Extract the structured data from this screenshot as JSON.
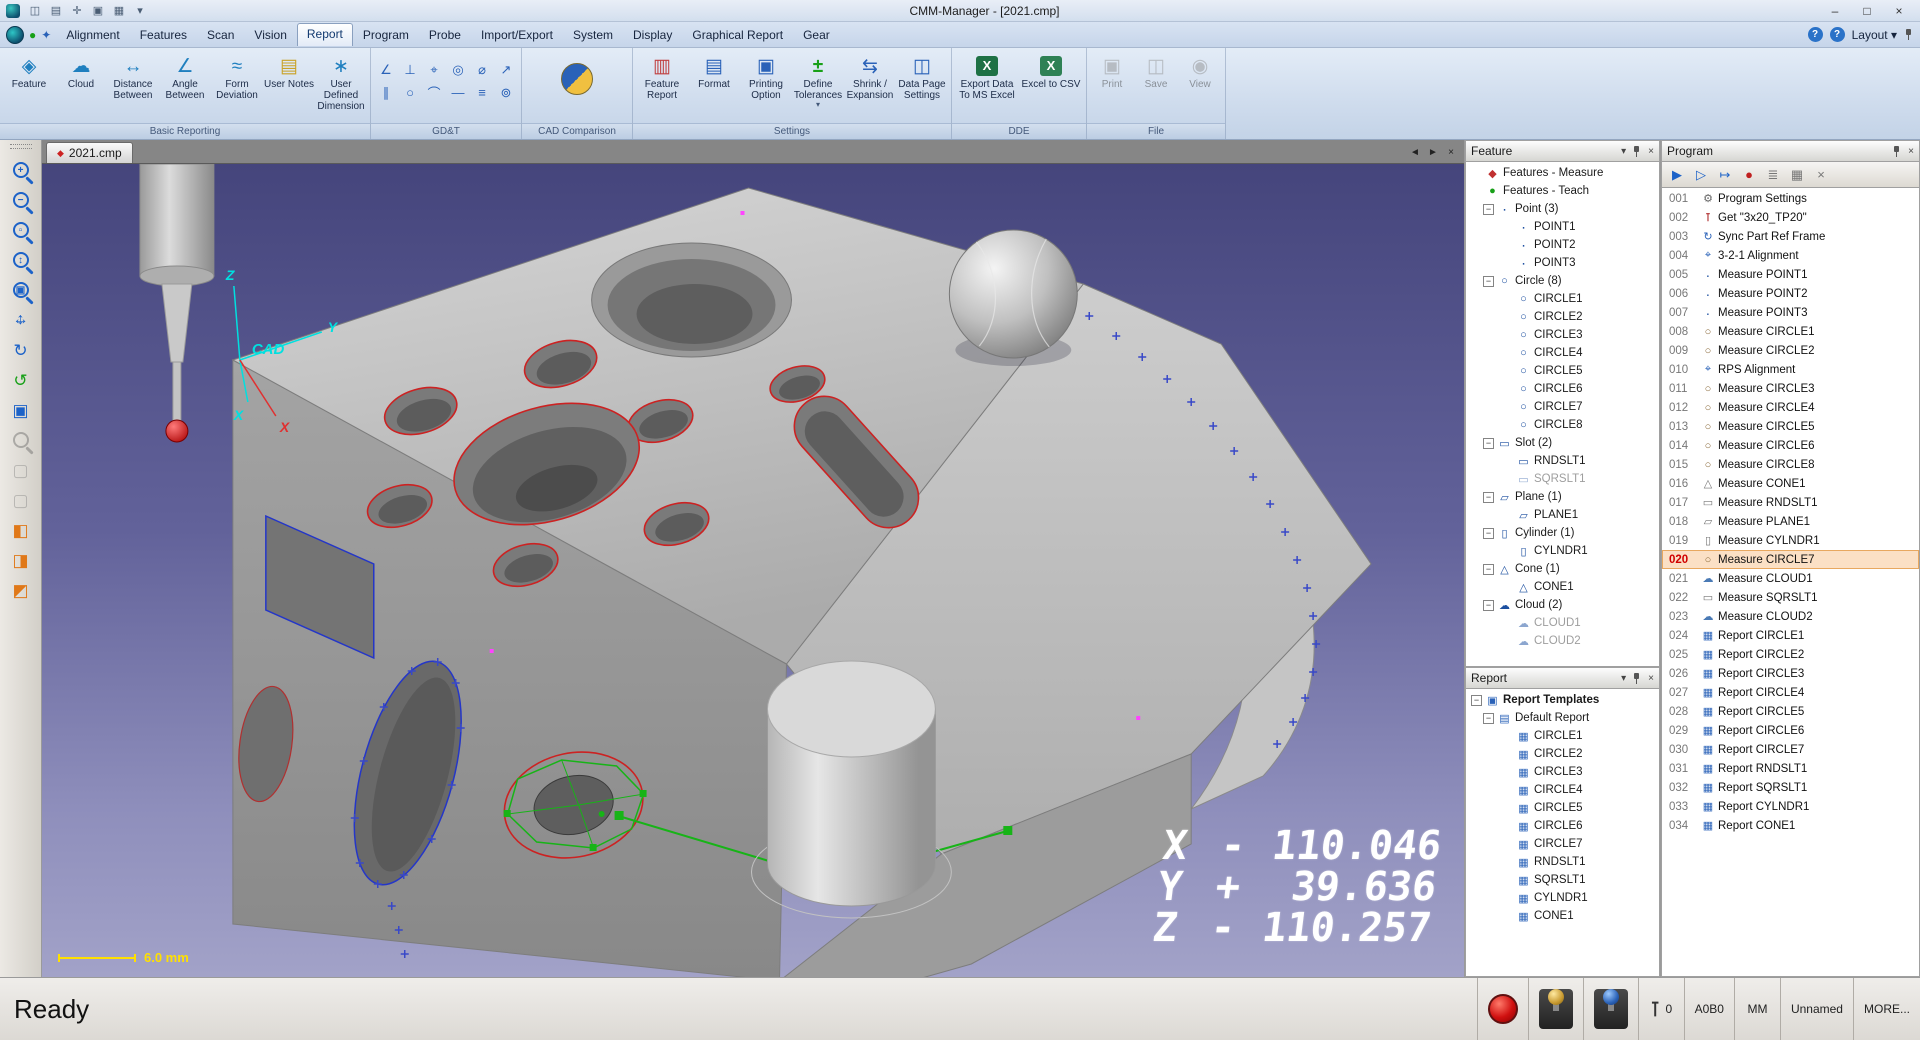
{
  "window": {
    "title": "CMM-Manager - [2021.cmp]",
    "controls": {
      "minimize": "–",
      "maximize": "□",
      "close": "×"
    },
    "quick_icons": [
      {
        "name": "save-icon",
        "glyph": "◫"
      },
      {
        "name": "print-icon",
        "glyph": "▤"
      },
      {
        "name": "probe-setup-icon",
        "glyph": "✛"
      },
      {
        "name": "display-mode-icon",
        "glyph": "▣"
      },
      {
        "name": "report-window-icon",
        "glyph": "▦"
      },
      {
        "name": "customize-quick-access-icon",
        "glyph": "▾"
      }
    ]
  },
  "menubar": {
    "items": [
      {
        "label": "Alignment"
      },
      {
        "label": "Features"
      },
      {
        "label": "Scan"
      },
      {
        "label": "Vision"
      },
      {
        "label": "Report",
        "cls": "active"
      },
      {
        "label": "Program"
      },
      {
        "label": "Probe"
      },
      {
        "label": "Import/Export"
      },
      {
        "label": "System"
      },
      {
        "label": "Display"
      },
      {
        "label": "Graphical Report"
      },
      {
        "label": "Gear"
      }
    ],
    "help_glyph": "?",
    "info_glyph": "?",
    "layout_label": "Layout",
    "layout_caret": "▾"
  },
  "ribbon": {
    "basic": {
      "label": "Basic Reporting",
      "buttons": [
        {
          "label": "Feature",
          "icon": "i-feature"
        },
        {
          "label": "Cloud",
          "icon": "i-cloud"
        },
        {
          "label": "Distance Between",
          "icon": "i-distance"
        },
        {
          "label": "Angle Between",
          "icon": "i-angle"
        },
        {
          "label": "Form Deviation",
          "icon": "i-form"
        },
        {
          "label": "User Notes",
          "icon": "i-notes"
        },
        {
          "label": "User Defined Dimension",
          "icon": "i-udd"
        }
      ]
    },
    "gdt": {
      "label": "GD&T",
      "tools": [
        {
          "name": "angularity-icon",
          "glyph": "∠"
        },
        {
          "name": "perpendicularity-icon",
          "glyph": "⊥"
        },
        {
          "name": "position-icon",
          "glyph": "⌖"
        },
        {
          "name": "concentricity-icon",
          "glyph": "◎"
        },
        {
          "name": "diameter-icon",
          "glyph": "⌀"
        },
        {
          "name": "runout-icon",
          "glyph": "↗"
        },
        {
          "name": "parallelism-icon",
          "glyph": "∥"
        },
        {
          "name": "circularity-icon",
          "glyph": "○"
        },
        {
          "name": "profile-icon",
          "glyph": "⌒"
        },
        {
          "name": "straightness-icon",
          "glyph": "—"
        },
        {
          "name": "symmetry-icon",
          "glyph": "≡"
        },
        {
          "name": "total-runout-icon",
          "glyph": "⊚"
        }
      ]
    },
    "cad": {
      "label": "CAD Comparison"
    },
    "settings": {
      "label": "Settings",
      "buttons": [
        {
          "label": "Feature Report",
          "icon": "i-freport"
        },
        {
          "label": "Format",
          "icon": "i-format"
        },
        {
          "label": "Printing Option",
          "icon": "i-print"
        },
        {
          "label": "Define Tolerances",
          "icon": "i-tol",
          "caret": "▾"
        },
        {
          "label": "Shrink / Expansion",
          "icon": "i-shrink"
        },
        {
          "label": "Data Page Settings",
          "icon": "i-datapage"
        }
      ]
    },
    "dde": {
      "label": "DDE",
      "buttons": [
        {
          "label": "Export Data To MS Excel",
          "icon": "i-excel"
        },
        {
          "label": "Excel to CSV",
          "icon": "i-excel2"
        }
      ]
    },
    "file": {
      "label": "File",
      "buttons": [
        {
          "label": "Print",
          "icon": "i-fprint",
          "cls": "disabled"
        },
        {
          "label": "Save",
          "icon": "i-fsave",
          "cls": "disabled"
        },
        {
          "label": "View",
          "icon": "i-fview",
          "cls": "disabled"
        }
      ]
    }
  },
  "side_toolbar": {
    "tools": [
      {
        "name": "zoom-in-tool",
        "cls": "kind-mag",
        "sub": "+"
      },
      {
        "name": "zoom-out-tool",
        "cls": "kind-mag",
        "sub": "−"
      },
      {
        "name": "zoom-window-tool",
        "cls": "kind-mag",
        "sub": "▫"
      },
      {
        "name": "zoom-dynamic-tool",
        "cls": "kind-mag",
        "sub": "↕"
      },
      {
        "name": "zoom-fit-tool",
        "cls": "kind-mag",
        "sub": "▣"
      },
      {
        "name": "pan-tool",
        "cls": "kind-pan"
      },
      {
        "name": "rotate-view-tool",
        "cls": "kind-glyph c-blue",
        "glyph": "↻"
      },
      {
        "name": "rotate-3d-tool",
        "cls": "kind-glyph c-green",
        "glyph": "↺"
      },
      {
        "name": "view-control-tool",
        "cls": "kind-glyph c-blue",
        "glyph": "▣"
      },
      {
        "name": "probe-zoom-tool",
        "cls": "kind-mag dis",
        "sub": ""
      },
      {
        "name": "select-feature-tool",
        "cls": "kind-glyph c-gray dis",
        "glyph": "▢"
      },
      {
        "name": "select-surface-tool",
        "cls": "kind-glyph c-gray dis",
        "glyph": "▢"
      },
      {
        "name": "iso-view-tool",
        "cls": "kind-glyph c-orange",
        "glyph": "◧"
      },
      {
        "name": "front-view-tool",
        "cls": "kind-glyph c-orange",
        "glyph": "◨"
      },
      {
        "name": "side-view-tool",
        "cls": "kind-glyph c-orange",
        "glyph": "◩"
      }
    ]
  },
  "viewport": {
    "tab": {
      "label": "2021.cmp",
      "icon_glyph": "◆"
    },
    "nav": {
      "prev": "◄",
      "next": "►",
      "close": "×"
    },
    "scale_label": "6.0 mm",
    "axis": {
      "z": "Z",
      "y": "Y",
      "x": "X",
      "x_red": "X",
      "cad": "CAD"
    },
    "dro": [
      {
        "axis": "X",
        "sign": "-",
        "value": "110.046"
      },
      {
        "axis": "Y",
        "sign": "+",
        "value": "39.636"
      },
      {
        "axis": "Z",
        "sign": "-",
        "value": "110.257"
      }
    ]
  },
  "feature_panel": {
    "title": "Feature",
    "rows": [
      {
        "cls": "lvl0",
        "icon": "t-measure",
        "label": "Features - Measure"
      },
      {
        "cls": "lvl0",
        "icon": "t-teach",
        "label": "Features - Teach"
      },
      {
        "cls": "lvl1",
        "exp": "box",
        "icon": "t-point",
        "label": "Point (3)"
      },
      {
        "cls": "lvl2",
        "icon": "t-point",
        "label": "POINT1"
      },
      {
        "cls": "lvl2",
        "icon": "t-point",
        "label": "POINT2"
      },
      {
        "cls": "lvl2",
        "icon": "t-point",
        "label": "POINT3"
      },
      {
        "cls": "lvl1",
        "exp": "box",
        "icon": "t-circle",
        "label": "Circle (8)"
      },
      {
        "cls": "lvl2",
        "icon": "t-circle",
        "label": "CIRCLE1"
      },
      {
        "cls": "lvl2",
        "icon": "t-circle",
        "label": "CIRCLE2"
      },
      {
        "cls": "lvl2",
        "icon": "t-circle",
        "label": "CIRCLE3"
      },
      {
        "cls": "lvl2",
        "icon": "t-circle",
        "label": "CIRCLE4"
      },
      {
        "cls": "lvl2",
        "icon": "t-circle",
        "label": "CIRCLE5"
      },
      {
        "cls": "lvl2",
        "icon": "t-circle",
        "label": "CIRCLE6"
      },
      {
        "cls": "lvl2",
        "icon": "t-circle",
        "label": "CIRCLE7"
      },
      {
        "cls": "lvl2",
        "icon": "t-circle",
        "label": "CIRCLE8"
      },
      {
        "cls": "lvl1",
        "exp": "box",
        "icon": "t-slot",
        "label": "Slot (2)"
      },
      {
        "cls": "lvl2",
        "icon": "t-slot",
        "label": "RNDSLT1"
      },
      {
        "cls": "lvl2 gray",
        "icon": "t-slot",
        "label": "SQRSLT1"
      },
      {
        "cls": "lvl1",
        "exp": "box",
        "icon": "t-plane",
        "label": "Plane (1)"
      },
      {
        "cls": "lvl2",
        "icon": "t-plane",
        "label": "PLANE1"
      },
      {
        "cls": "lvl1",
        "exp": "box",
        "icon": "t-cyl",
        "label": "Cylinder (1)"
      },
      {
        "cls": "lvl2",
        "icon": "t-cyl",
        "label": "CYLNDR1"
      },
      {
        "cls": "lvl1",
        "exp": "box",
        "icon": "t-cone",
        "label": "Cone (1)"
      },
      {
        "cls": "lvl2",
        "icon": "t-cone",
        "label": "CONE1"
      },
      {
        "cls": "lvl1",
        "exp": "box",
        "icon": "t-cloud",
        "label": "Cloud (2)"
      },
      {
        "cls": "lvl2 gray",
        "icon": "t-cloud",
        "label": "CLOUD1"
      },
      {
        "cls": "lvl2 gray",
        "icon": "t-cloud",
        "label": "CLOUD2"
      }
    ]
  },
  "report_panel": {
    "title": "Report",
    "rows": [
      {
        "cls": "lvl0 bold",
        "exp": "box",
        "icon": "t-rpt-root",
        "label": "Report Templates"
      },
      {
        "cls": "lvl1",
        "exp": "box",
        "icon": "t-rpt",
        "label": "Default Report"
      },
      {
        "cls": "lvl2",
        "icon": "t-rpt-i",
        "label": "CIRCLE1"
      },
      {
        "cls": "lvl2",
        "icon": "t-rpt-i",
        "label": "CIRCLE2"
      },
      {
        "cls": "lvl2",
        "icon": "t-rpt-i",
        "label": "CIRCLE3"
      },
      {
        "cls": "lvl2",
        "icon": "t-rpt-i",
        "label": "CIRCLE4"
      },
      {
        "cls": "lvl2",
        "icon": "t-rpt-i",
        "label": "CIRCLE5"
      },
      {
        "cls": "lvl2",
        "icon": "t-rpt-i",
        "label": "CIRCLE6"
      },
      {
        "cls": "lvl2",
        "icon": "t-rpt-i",
        "label": "CIRCLE7"
      },
      {
        "cls": "lvl2",
        "icon": "t-rpt-i",
        "label": "RNDSLT1"
      },
      {
        "cls": "lvl2",
        "icon": "t-rpt-i",
        "label": "SQRSLT1"
      },
      {
        "cls": "lvl2",
        "icon": "t-rpt-i",
        "label": "CYLNDR1"
      },
      {
        "cls": "lvl2",
        "icon": "t-rpt-i",
        "label": "CONE1"
      }
    ]
  },
  "program_panel": {
    "title": "Program",
    "toolbar": [
      {
        "name": "run-program-button",
        "glyph": "▶",
        "cls": "c-blue"
      },
      {
        "name": "run-from-current-button",
        "glyph": "▷",
        "cls": "c-blue"
      },
      {
        "name": "step-run-button",
        "glyph": "↦",
        "cls": "c-blue"
      },
      {
        "name": "breakpoint-button",
        "glyph": "●",
        "cls": "c-red"
      },
      {
        "name": "list-options-button",
        "glyph": "≣",
        "cls": "c-gray"
      },
      {
        "name": "program-windows-button",
        "glyph": "▦",
        "cls": "c-gray"
      },
      {
        "name": "delete-line-button",
        "glyph": "×",
        "cls": "c-gray"
      }
    ],
    "rows": [
      {
        "num": "001",
        "icon": "k-settings",
        "label": "Program Settings"
      },
      {
        "num": "002",
        "icon": "k-probe",
        "label": "Get \"3x20_TP20\""
      },
      {
        "num": "003",
        "icon": "k-sync",
        "label": "Sync Part Ref Frame"
      },
      {
        "num": "004",
        "icon": "k-align",
        "label": "3-2-1 Alignment"
      },
      {
        "num": "005",
        "icon": "k-point",
        "label": "Measure POINT1"
      },
      {
        "num": "006",
        "icon": "k-point",
        "label": "Measure POINT2"
      },
      {
        "num": "007",
        "icon": "k-point",
        "label": "Measure POINT3"
      },
      {
        "num": "008",
        "icon": "k-circle",
        "label": "Measure CIRCLE1"
      },
      {
        "num": "009",
        "icon": "k-circle",
        "label": "Measure CIRCLE2"
      },
      {
        "num": "010",
        "icon": "k-align",
        "label": "RPS Alignment"
      },
      {
        "num": "011",
        "icon": "k-circle",
        "label": "Measure CIRCLE3"
      },
      {
        "num": "012",
        "icon": "k-circle",
        "label": "Measure CIRCLE4"
      },
      {
        "num": "013",
        "icon": "k-circle",
        "label": "Measure CIRCLE5"
      },
      {
        "num": "014",
        "icon": "k-circle",
        "label": "Measure CIRCLE6"
      },
      {
        "num": "015",
        "icon": "k-circle",
        "label": "Measure CIRCLE8"
      },
      {
        "num": "016",
        "icon": "k-cone",
        "label": "Measure CONE1"
      },
      {
        "num": "017",
        "icon": "k-slot",
        "label": "Measure RNDSLT1"
      },
      {
        "num": "018",
        "icon": "k-plane",
        "label": "Measure PLANE1"
      },
      {
        "num": "019",
        "icon": "k-cyl",
        "label": "Measure CYLNDR1"
      },
      {
        "num": "020",
        "icon": "k-circle",
        "label": "Measure CIRCLE7",
        "cls": "sel"
      },
      {
        "num": "021",
        "icon": "k-cloud",
        "label": "Measure CLOUD1"
      },
      {
        "num": "022",
        "icon": "k-slot",
        "label": "Measure SQRSLT1"
      },
      {
        "num": "023",
        "icon": "k-cloud",
        "label": "Measure CLOUD2"
      },
      {
        "num": "024",
        "icon": "k-report",
        "label": "Report CIRCLE1"
      },
      {
        "num": "025",
        "icon": "k-report",
        "label": "Report CIRCLE2"
      },
      {
        "num": "026",
        "icon": "k-report",
        "label": "Report CIRCLE3"
      },
      {
        "num": "027",
        "icon": "k-report",
        "label": "Report CIRCLE4"
      },
      {
        "num": "028",
        "icon": "k-report",
        "label": "Report CIRCLE5"
      },
      {
        "num": "029",
        "icon": "k-report",
        "label": "Report CIRCLE6"
      },
      {
        "num": "030",
        "icon": "k-report",
        "label": "Report CIRCLE7"
      },
      {
        "num": "031",
        "icon": "k-report",
        "label": "Report RNDSLT1"
      },
      {
        "num": "032",
        "icon": "k-report",
        "label": "Report SQRSLT1"
      },
      {
        "num": "033",
        "icon": "k-report",
        "label": "Report CYLNDR1"
      },
      {
        "num": "034",
        "icon": "k-report",
        "label": "Report CONE1"
      }
    ]
  },
  "statusbar": {
    "ready": "Ready",
    "probe_count": "0",
    "cells": [
      {
        "label": "A0B0"
      },
      {
        "label": "MM"
      },
      {
        "label": "Unnamed"
      },
      {
        "label": "MORE..."
      }
    ]
  }
}
